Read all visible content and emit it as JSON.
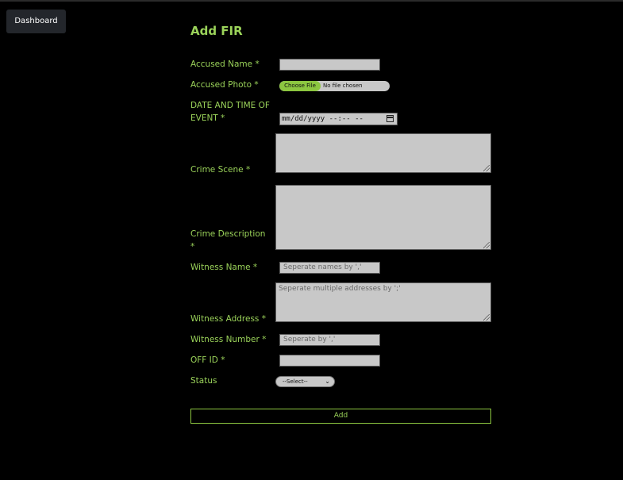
{
  "nav": {
    "dashboard_label": "Dashboard"
  },
  "form": {
    "title": "Add FIR",
    "accused_name": {
      "label": "Accused Name *",
      "value": ""
    },
    "accused_photo": {
      "label": "Accused Photo *",
      "button_label": "Choose File",
      "status": "No file chosen"
    },
    "datetime": {
      "label_line1": "DATE AND TIME OF",
      "label_line2": "EVENT *",
      "value": "mm/dd/yyyy --:-- --"
    },
    "crime_scene": {
      "label": "Crime Scene *",
      "value": ""
    },
    "crime_description": {
      "label_line1": "Crime Description",
      "label_line2": "*",
      "value": ""
    },
    "witness_name": {
      "label": "Witness Name *",
      "placeholder": "Seperate names by ','"
    },
    "witness_address": {
      "label": "Witness Address *",
      "placeholder": "Seperate multiple addresses by ';'"
    },
    "witness_number": {
      "label": "Witness Number *",
      "placeholder": "Seperate by ','"
    },
    "off_id": {
      "label": "OFF ID *",
      "value": ""
    },
    "status": {
      "label": "Status",
      "selected": "--Select--"
    },
    "submit_label": "Add"
  },
  "colors": {
    "accent": "#9bd35a",
    "button_green": "#8cc640",
    "field_bg": "#c8c8c8",
    "page_bg": "#000000"
  }
}
